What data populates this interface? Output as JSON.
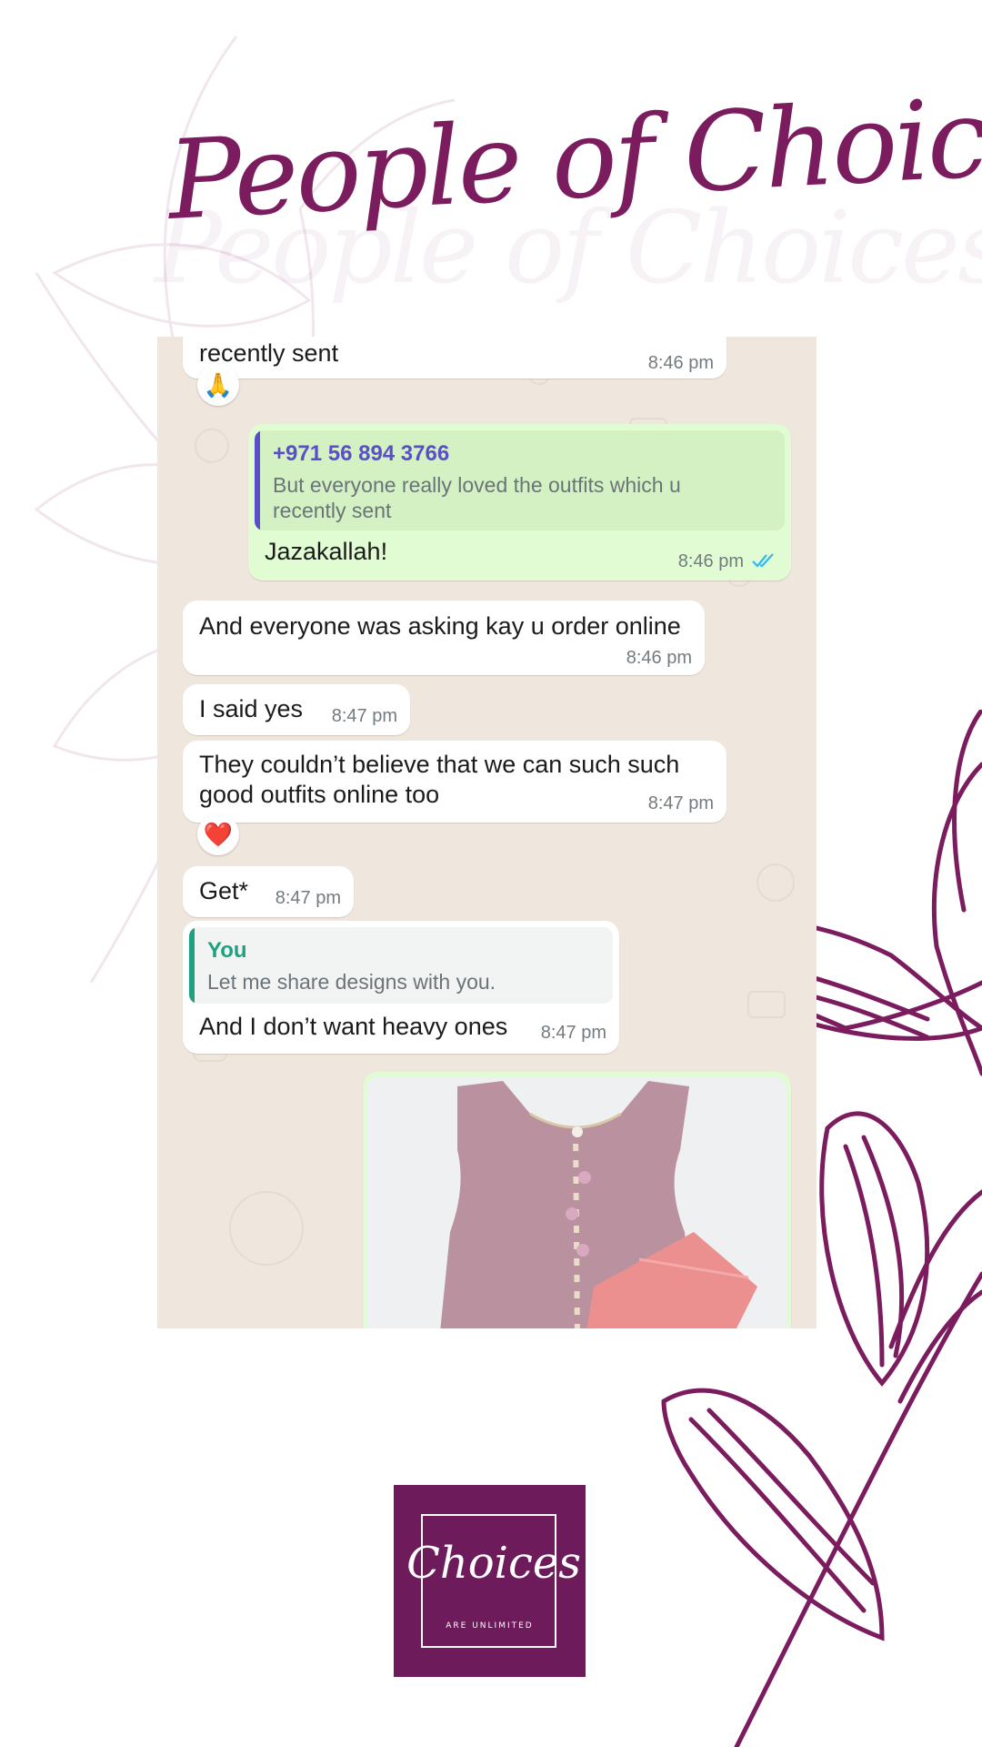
{
  "headline": "People of Choices",
  "chat": {
    "messages": [
      {
        "text": "recently sent",
        "time": "8:46 pm"
      },
      {
        "reaction": "🙏"
      },
      {
        "quote_author": "+971 56 894 3766",
        "quote_text": "But everyone really loved the outfits which u recently sent",
        "text": "Jazakallah!",
        "time": "8:46 pm"
      },
      {
        "text": "And everyone was asking kay u order online",
        "time": "8:46 pm"
      },
      {
        "text": "I said yes",
        "time": "8:47 pm"
      },
      {
        "text_line1": "They couldn’t believe that we can such such",
        "text_line2": "good outfits online too",
        "time": "8:47 pm"
      },
      {
        "reaction": "❤️"
      },
      {
        "text": "Get*",
        "time": "8:47 pm"
      },
      {
        "quote_author": "You",
        "quote_text": "Let me share designs with you.",
        "text": "And I don’t want heavy ones",
        "time": "8:47 pm"
      }
    ]
  },
  "logo": {
    "word": "Choices",
    "tagline": "ARE UNLIMITED"
  },
  "colors": {
    "brand": "#6d1b5b",
    "chat_bg": "#efe6dd",
    "outgoing_bubble": "#e1fcd2",
    "quote_author_phone": "#5b4fc9",
    "quote_author_you": "#1fa07e",
    "read_ticks": "#34b7f1"
  }
}
